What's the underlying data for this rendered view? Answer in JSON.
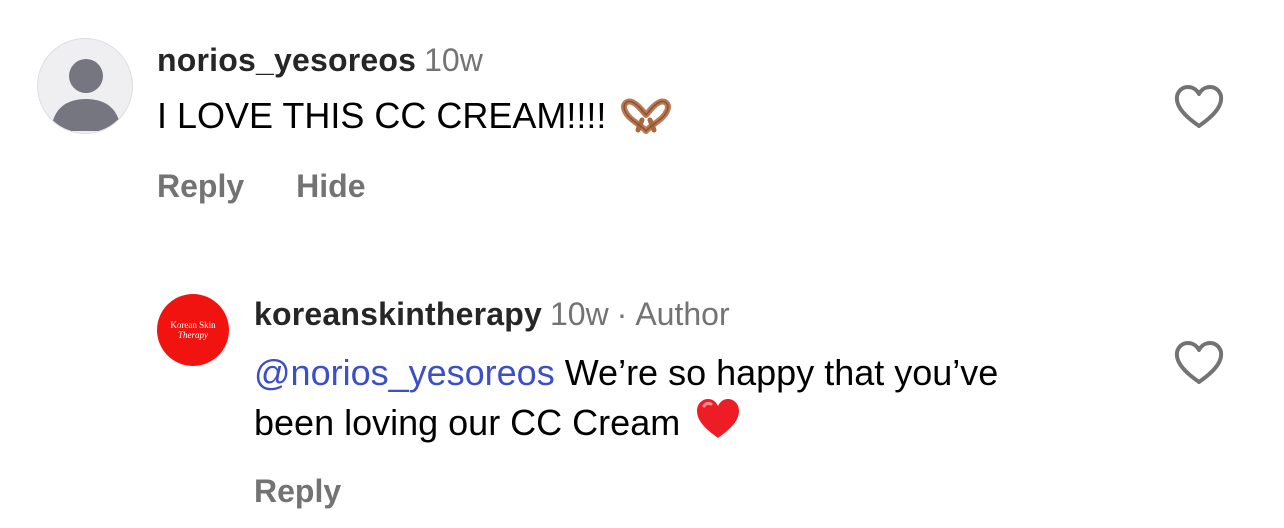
{
  "comments": [
    {
      "username": "norios_yesoreos",
      "time": "10w",
      "text": "I LOVE THIS CC CREAM!!!!",
      "emoji": "heart-hands",
      "avatar_icon": "default-profile-icon",
      "actions": {
        "reply": "Reply",
        "hide": "Hide"
      },
      "like_icon": "heart-outline-icon"
    },
    {
      "username": "koreanskintherapy",
      "time": "10w",
      "separator": "·",
      "badge": "Author",
      "mention": "@norios_yesoreos",
      "text": "We’re so happy that you’ve been loving our CC Cream",
      "emoji": "red-heart",
      "avatar_text": {
        "line1": "Korean Skin",
        "line2": "Therapy"
      },
      "actions": {
        "reply": "Reply"
      },
      "like_icon": "heart-outline-icon"
    }
  ],
  "colors": {
    "text": "#000000",
    "username": "#262626",
    "secondary": "#737373",
    "mention": "#3C4FC7",
    "brand_red": "#F0130F"
  }
}
